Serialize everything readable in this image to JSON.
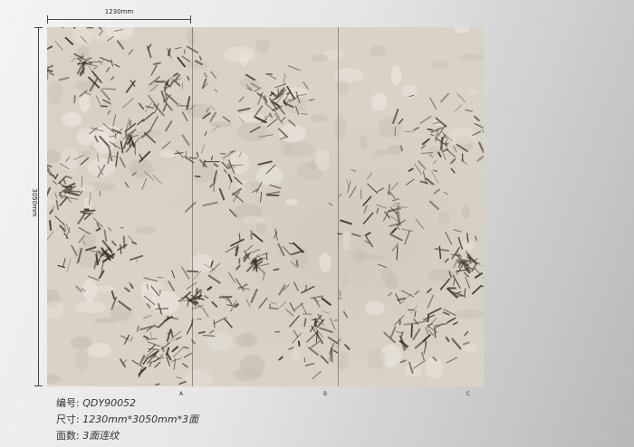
{
  "dimensions": {
    "width_label": "1230mm",
    "height_label": "3050mm"
  },
  "panels": [
    {
      "label": "A"
    },
    {
      "label": "B"
    },
    {
      "label": "C"
    }
  ],
  "info": {
    "code_key": "编号:",
    "code_value": "QDY90052",
    "size_key": "尺寸:",
    "size_value": "1230mm*3050mm*3面",
    "faces_key": "面数:",
    "faces_value": "3面连纹"
  },
  "colors": {
    "stone_base": "#d9d2c6",
    "vein_dark": "#3b3026",
    "vein_mid": "#6a5a4a"
  }
}
